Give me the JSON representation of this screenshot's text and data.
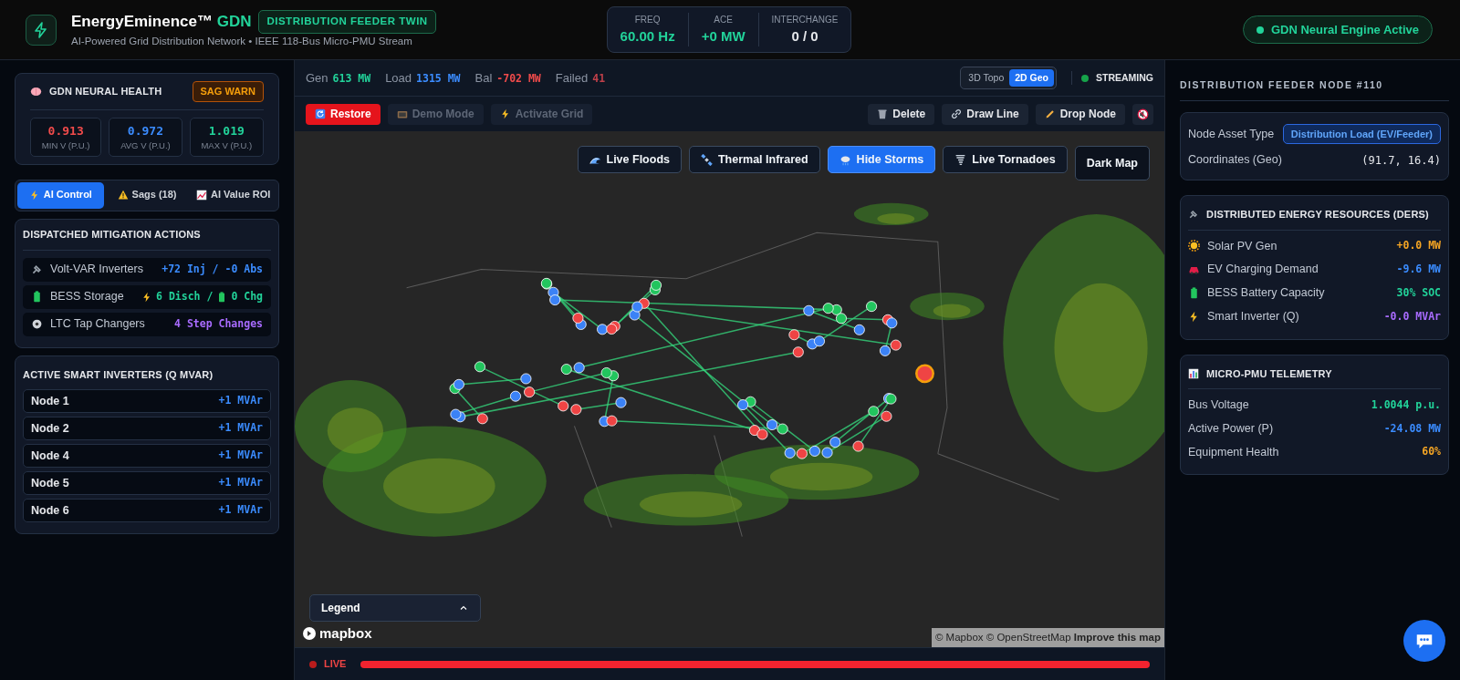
{
  "header": {
    "title": "EnergyEminence™",
    "title_accent": "GDN",
    "badge": "DISTRIBUTION FEEDER TWIN",
    "subtitle": "AI-Powered Grid Distribution Network • IEEE 118-Bus Micro-PMU Stream",
    "metrics": [
      {
        "label": "FREQ",
        "value": "60.00 Hz",
        "color": "#22d39a"
      },
      {
        "label": "ACE",
        "value": "+0 MW",
        "color": "#22d39a"
      },
      {
        "label": "INTERCHANGE",
        "value": "0 / 0",
        "color": "#e5e7eb"
      }
    ],
    "status": "GDN Neural Engine Active"
  },
  "health": {
    "title": "GDN NEURAL HEALTH",
    "badge": "SAG WARN",
    "stats": [
      {
        "value": "0.913",
        "label": "MIN V (P.U.)",
        "color": "#f04b4b"
      },
      {
        "value": "0.972",
        "label": "AVG V (P.U.)",
        "color": "#3b8cff"
      },
      {
        "value": "1.019",
        "label": "MAX V (P.U.)",
        "color": "#22d39a"
      }
    ]
  },
  "tabs": [
    {
      "label": "AI Control",
      "selected": true
    },
    {
      "label": "Sags (18)",
      "selected": false
    },
    {
      "label": "AI Value ROI",
      "selected": false
    }
  ],
  "mitigation": {
    "title": "DISPATCHED MITIGATION ACTIONS",
    "rows": [
      {
        "kind": "text",
        "label": "Volt-VAR Inverters",
        "value": "+72 Inj / -0 Abs",
        "color": "#3b8cff"
      },
      {
        "kind": "storage",
        "label": "BESS Storage",
        "discharge": "6 Disch /",
        "charge": "0 Chg",
        "color": "#22d39a"
      },
      {
        "kind": "text",
        "label": "LTC Tap Changers",
        "value": "4 Step Changes",
        "color": "#a86bff"
      }
    ]
  },
  "inverters": {
    "title": "ACTIVE SMART INVERTERS (Q MVAR)",
    "rows": [
      {
        "name": "Node 1",
        "value": "+1 MVAr"
      },
      {
        "name": "Node 2",
        "value": "+1 MVAr"
      },
      {
        "name": "Node 4",
        "value": "+1 MVAr"
      },
      {
        "name": "Node 5",
        "value": "+1 MVAr"
      },
      {
        "name": "Node 6",
        "value": "+1 MVAr"
      }
    ]
  },
  "map": {
    "stats": [
      {
        "label": "Gen",
        "value": "613 MW",
        "color": "#22d39a"
      },
      {
        "label": "Load",
        "value": "1315 MW",
        "color": "#3b8cff"
      },
      {
        "label": "Bal",
        "value": "-702 MW",
        "color": "#f04b4b"
      },
      {
        "label": "Failed",
        "value": "41",
        "color": "#c0404a"
      }
    ],
    "views": [
      {
        "label": "3D Topo",
        "selected": false
      },
      {
        "label": "2D Geo",
        "selected": true
      }
    ],
    "stream_status": "STREAMING",
    "actions_left": [
      {
        "label": "Restore",
        "disabled": false
      },
      {
        "label": "Demo Mode",
        "disabled": true
      },
      {
        "label": "Activate Grid",
        "disabled": true
      }
    ],
    "actions_right": [
      {
        "label": "Delete"
      },
      {
        "label": "Draw Line"
      },
      {
        "label": "Drop Node"
      }
    ],
    "layers": [
      {
        "label": "Live Floods",
        "selected": false
      },
      {
        "label": "Thermal Infrared",
        "selected": false
      },
      {
        "label": "Hide Storms",
        "selected": true
      },
      {
        "label": "Live Tornadoes",
        "selected": false
      },
      {
        "label": "Dark Map",
        "selected": false
      }
    ],
    "legend": "Legend",
    "logo": "mapbox",
    "attribution": "© Mapbox © OpenStreetMap",
    "attribution_link": "Improve this map",
    "live": {
      "label": "LIVE",
      "level": 1
    }
  },
  "node": {
    "title": "DISTRIBUTION FEEDER NODE #110",
    "asset_label": "Node Asset Type",
    "asset_badge": "Distribution Load (EV/Feeder)",
    "coords_label": "Coordinates (Geo)",
    "coords_value": "(91.7, 16.4)",
    "ders": {
      "title": "DISTRIBUTED ENERGY RESOURCES (DERS)",
      "rows": [
        {
          "label": "Solar PV Gen",
          "value": "+0.0 MW",
          "color": "#f5a524"
        },
        {
          "label": "EV Charging Demand",
          "value": "-9.6 MW",
          "color": "#3b8cff"
        },
        {
          "label": "BESS Battery Capacity",
          "value": "30% SOC",
          "color": "#22d39a"
        },
        {
          "label": "Smart Inverter (Q)",
          "value": "-0.0 MVAr",
          "color": "#a86bff"
        }
      ]
    },
    "telemetry": {
      "title": "MICRO-PMU TELEMETRY",
      "rows": [
        {
          "label": "Bus Voltage",
          "value": "1.0044 p.u.",
          "color": "#22d39a"
        },
        {
          "label": "Active Power (P)",
          "value": "-24.08 MW",
          "color": "#3b8cff"
        },
        {
          "label": "Equipment Health",
          "value": "60%",
          "color": "#f5a524"
        }
      ]
    }
  }
}
